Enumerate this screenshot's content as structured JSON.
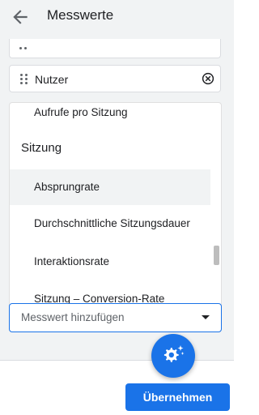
{
  "header": {
    "title": "Messwerte",
    "back_icon": "arrow-left-icon"
  },
  "selected_chips": [
    {
      "label": "Nutzer",
      "remove_icon": "close-circle-icon"
    }
  ],
  "metric_list": {
    "items": [
      {
        "label": "Aufrufe pro Sitzung",
        "type": "item"
      },
      {
        "label": "Sitzung",
        "type": "group"
      },
      {
        "label": "Absprungrate",
        "type": "item",
        "highlighted": true
      },
      {
        "label": "Durchschnittliche Sitzungsdauer",
        "type": "item"
      },
      {
        "label": "Interaktionsrate",
        "type": "item"
      },
      {
        "label": "Sitzung – Conversion-Rate",
        "type": "item"
      }
    ]
  },
  "add_metric": {
    "placeholder": "Messwert hinzufügen"
  },
  "fab": {
    "icon": "settings-sparkle-icon"
  },
  "footer": {
    "apply_label": "Übernehmen"
  },
  "colors": {
    "accent": "#1a73e8",
    "background": "#f1f3f4",
    "hover": "#f1f3f4"
  }
}
